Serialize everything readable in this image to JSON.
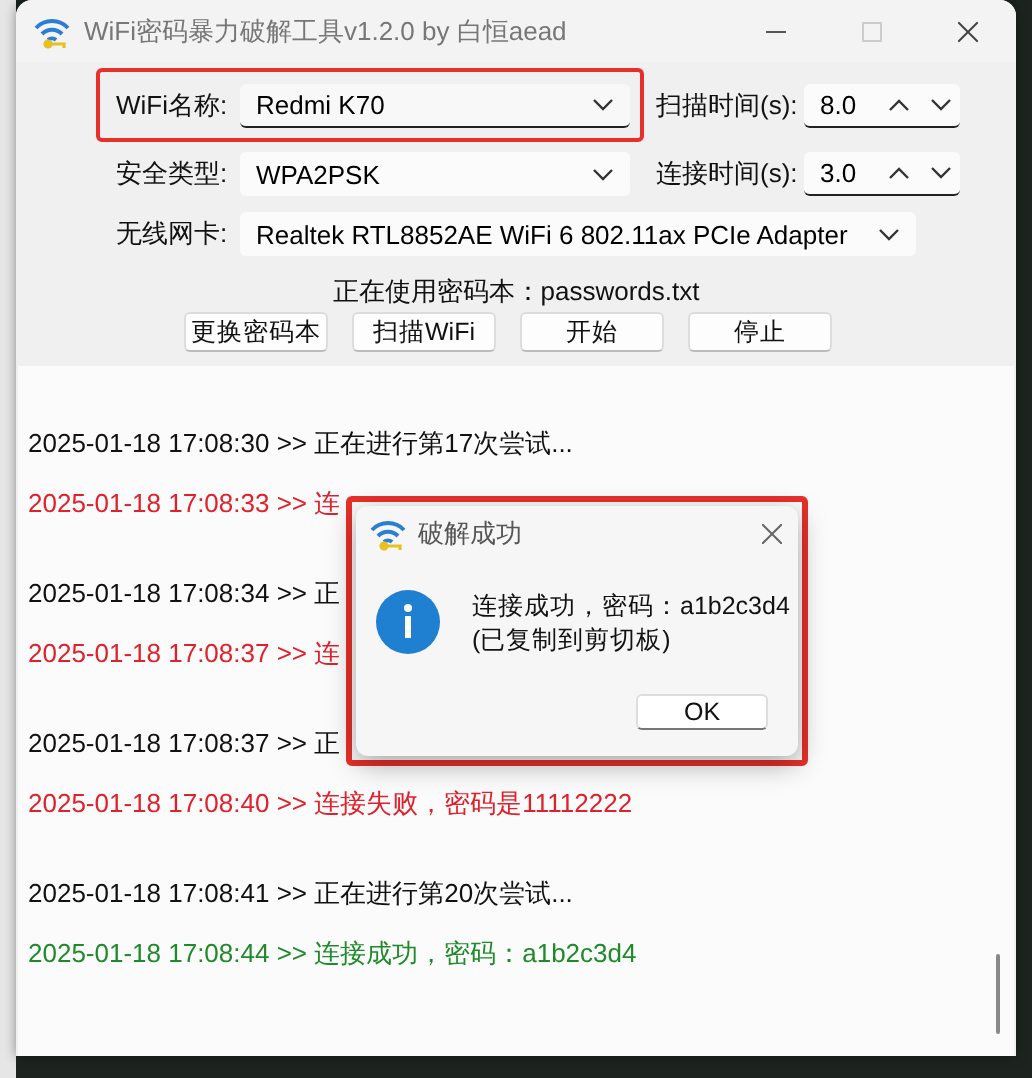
{
  "window": {
    "title": "WiFi密码暴力破解工具v1.2.0 by 白恒aead"
  },
  "form": {
    "wifi_name": {
      "label": "WiFi名称:",
      "value": "Redmi K70",
      "highlighted": true
    },
    "scan_time": {
      "label": "扫描时间(s):",
      "value": "8.0"
    },
    "security": {
      "label": "安全类型:",
      "value": "WPA2PSK"
    },
    "connect_time": {
      "label": "连接时间(s):",
      "value": "3.0"
    },
    "adapter": {
      "label": "无线网卡:",
      "value": "Realtek RTL8852AE WiFi 6 802.11ax PCIe Adapter"
    }
  },
  "dictionary_status": "正在使用密码本：passwords.txt",
  "buttons": [
    "更换密码本",
    "扫描WiFi",
    "开始",
    "停止"
  ],
  "log": [
    {
      "kind": "info",
      "text": "2025-01-18 17:08:30 >> 正在进行第17次尝试..."
    },
    {
      "kind": "fail",
      "text": "2025-01-18 17:08:33 >> 连"
    },
    {
      "kind": "info",
      "text": "2025-01-18 17:08:34 >> 正"
    },
    {
      "kind": "fail",
      "text": "2025-01-18 17:08:37 >> 连"
    },
    {
      "kind": "info",
      "text": "2025-01-18 17:08:37 >> 正"
    },
    {
      "kind": "fail",
      "text": "2025-01-18 17:08:40 >> 连接失败，密码是11112222"
    },
    {
      "kind": "info",
      "text": "2025-01-18 17:08:41 >> 正在进行第20次尝试..."
    },
    {
      "kind": "success",
      "text": "2025-01-18 17:08:44 >> 连接成功，密码：a1b2c3d4"
    }
  ],
  "dialog": {
    "title": "破解成功",
    "message": "连接成功，密码：a1b2c3d4",
    "note": "(已复制到剪切板)",
    "button": "OK",
    "highlighted": true
  }
}
